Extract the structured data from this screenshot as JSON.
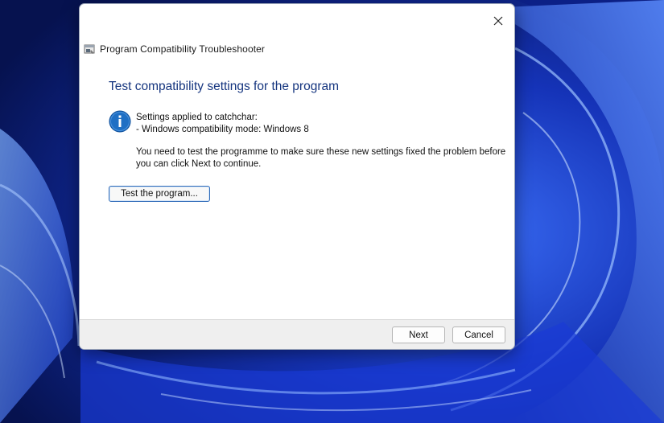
{
  "window": {
    "title": "Program Compatibility Troubleshooter",
    "close_icon": "close-icon",
    "app_icon": "troubleshooter-icon"
  },
  "content": {
    "heading": "Test compatibility settings for the program",
    "info_icon": "info-icon",
    "settings_line1": "Settings applied to catchchar:",
    "settings_line2": "- Windows compatibility mode: Windows 8",
    "message": "You need to test the programme to make sure these new settings fixed the problem before you can click Next to continue.",
    "test_button": "Test the program..."
  },
  "footer": {
    "next_label": "Next",
    "cancel_label": "Cancel"
  },
  "colors": {
    "heading": "#15357f",
    "info_icon": "#1f6fc4",
    "wallpaper": "#0a1a6e"
  }
}
